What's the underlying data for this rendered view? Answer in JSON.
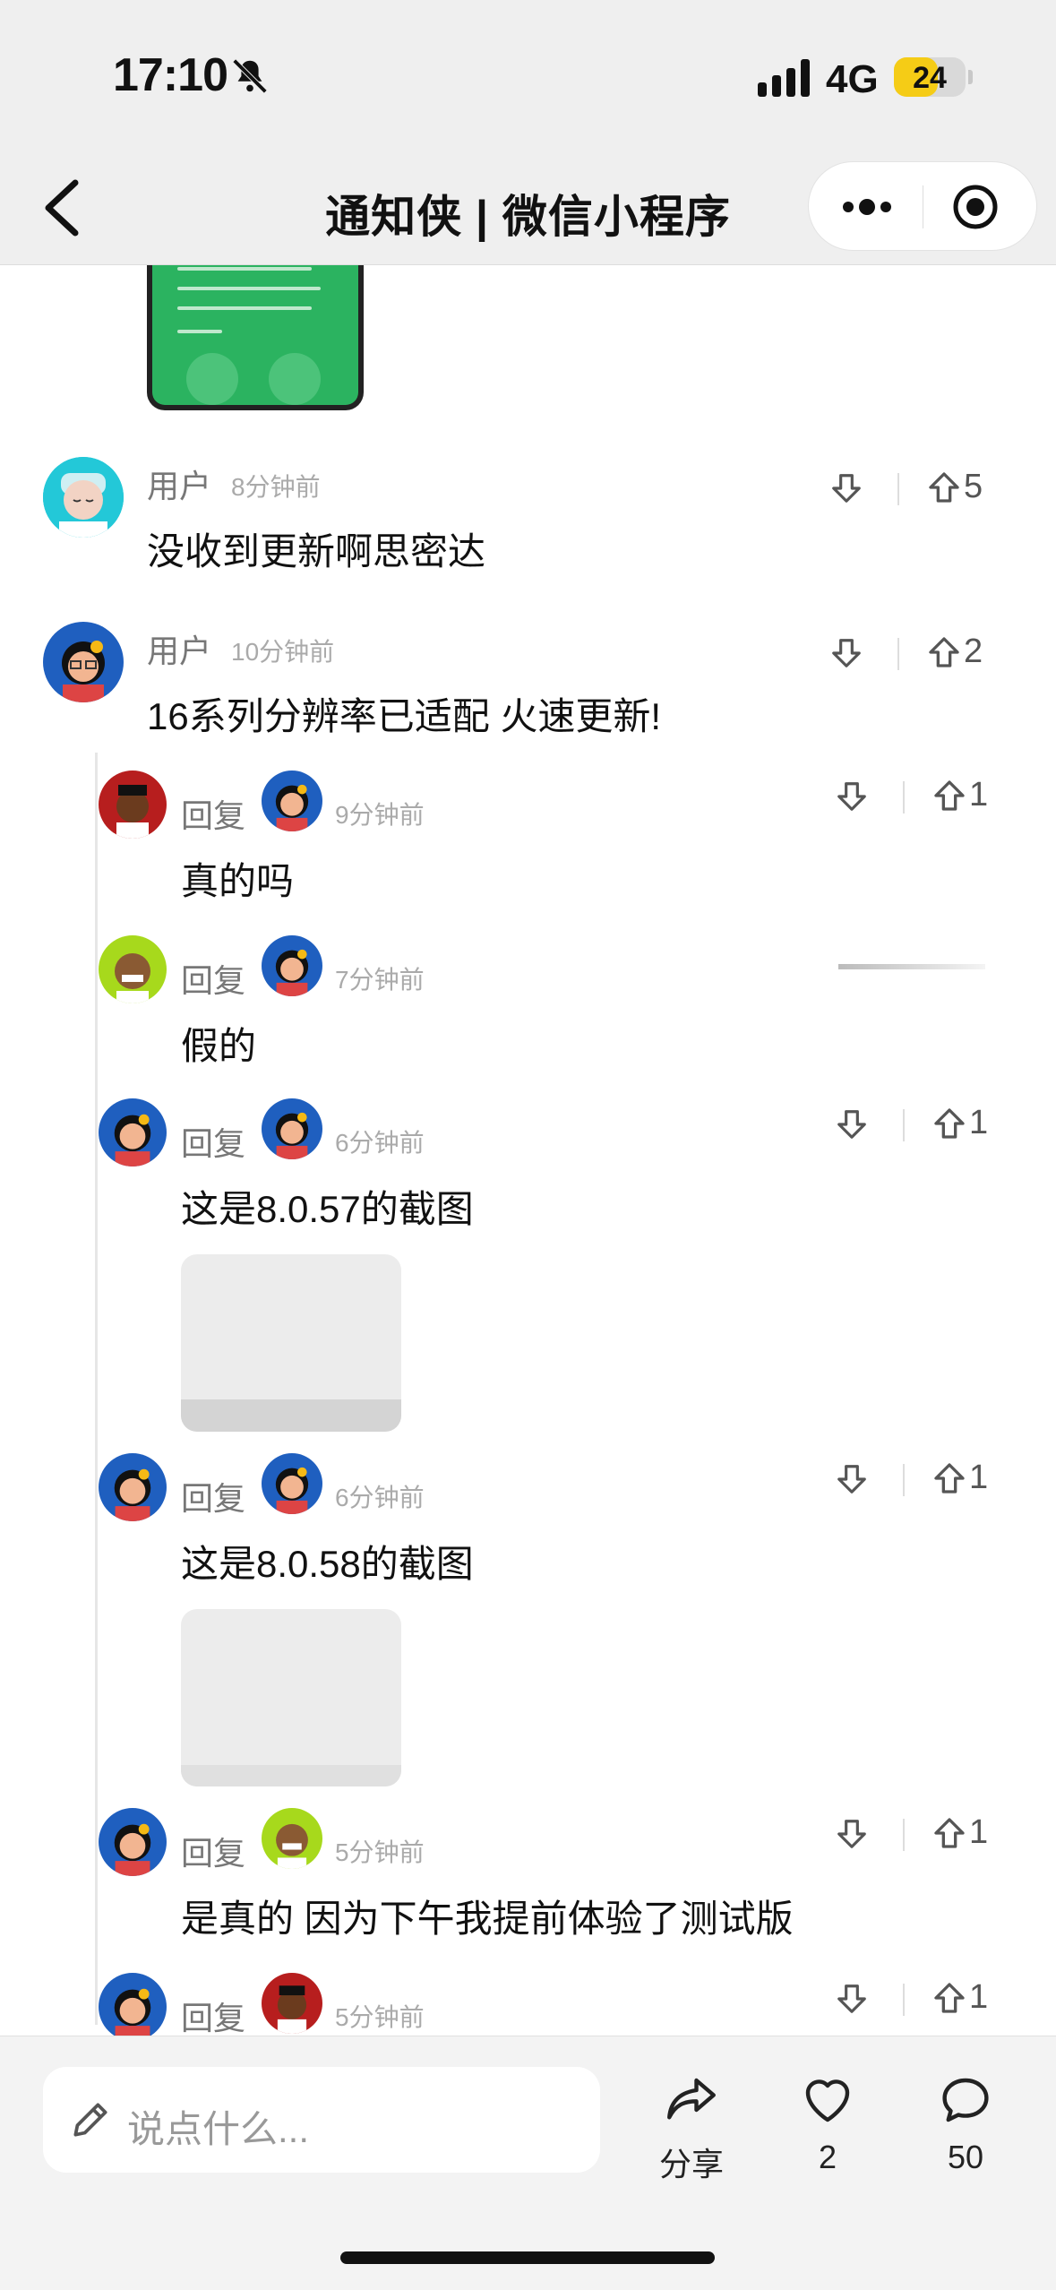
{
  "status_bar": {
    "time": "17:10",
    "network": "4G",
    "battery": "24",
    "battery_level": 0.24
  },
  "nav": {
    "title": "通知侠 | 微信小程序"
  },
  "comments": [
    {
      "user": "用户",
      "time": "8分钟前",
      "text": "没收到更新啊思密达",
      "votes": "5"
    },
    {
      "user": "用户",
      "time": "10分钟前",
      "text": "16系列分辨率已适配 火速更新!",
      "votes": "2"
    }
  ],
  "replies": [
    {
      "label": "回复",
      "time": "9分钟前",
      "text": "真的吗",
      "votes": "1"
    },
    {
      "label": "回复",
      "time": "7分钟前",
      "text": "假的",
      "votes": ""
    },
    {
      "label": "回复",
      "time": "6分钟前",
      "text": "这是8.0.57的截图",
      "votes": "1"
    },
    {
      "label": "回复",
      "time": "6分钟前",
      "text": "这是8.0.58的截图",
      "votes": "1"
    },
    {
      "label": "回复",
      "time": "5分钟前",
      "text": "是真的 因为下午我提前体验了测试版",
      "votes": "1"
    },
    {
      "label": "回复",
      "time": "5分钟前",
      "text": "",
      "votes": "1"
    }
  ],
  "bottom_bar": {
    "input_placeholder": "说点什么...",
    "share_label": "分享",
    "like_count": "2",
    "comment_count": "50"
  },
  "colors": {
    "battery": "#f5cc16",
    "thumb_green": "#2bb360"
  }
}
